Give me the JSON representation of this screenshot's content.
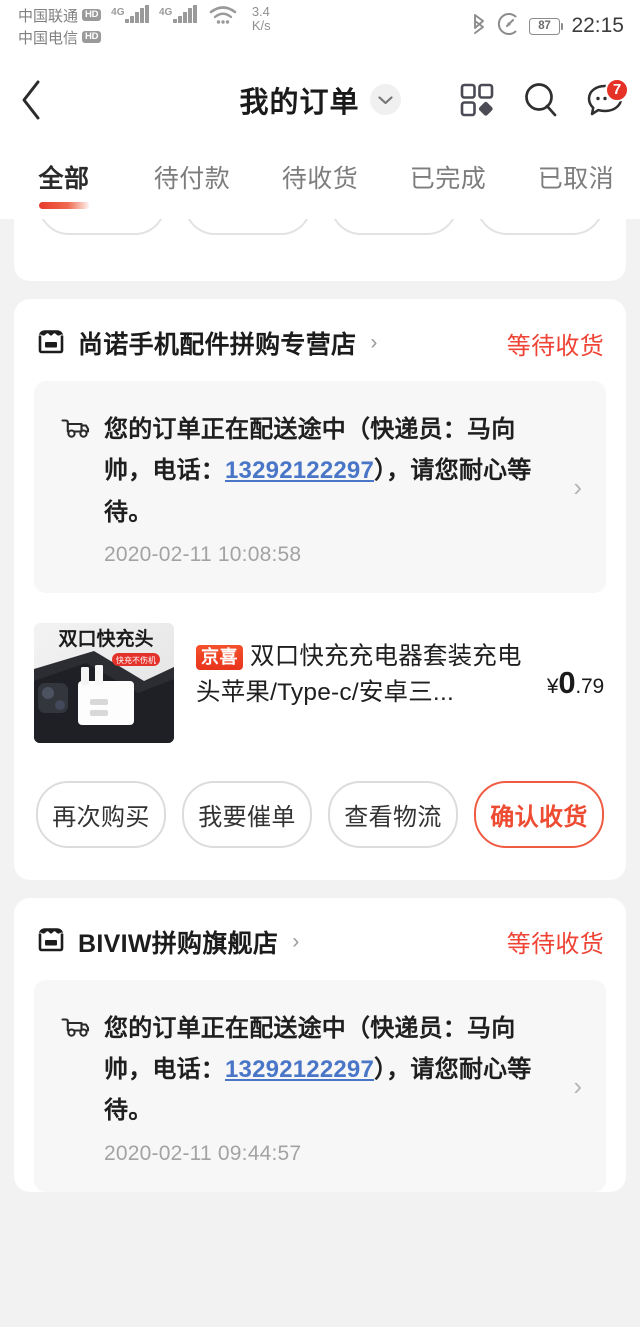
{
  "status_bar": {
    "carrier_1": "中国联通",
    "carrier_1_hd": "HD",
    "carrier_1_gen": "4G",
    "carrier_2": "中国电信",
    "carrier_2_hd": "HD",
    "carrier_2_gen": "4G",
    "net_speed_value": "3.4",
    "net_speed_unit": "K/s",
    "battery_percent": "87",
    "time": "22:15",
    "icons": [
      "bluetooth-icon",
      "data-saver-icon",
      "wifi-icon",
      "battery-icon"
    ]
  },
  "header": {
    "title": "我的订单",
    "back_icon": "chevron-left-icon",
    "dropdown_icon": "chevron-down-icon",
    "grid_icon": "grid-apps-icon",
    "search_icon": "search-icon",
    "chat_icon": "chat-bubble-icon",
    "chat_badge": "7"
  },
  "tabs": [
    {
      "label": "全部",
      "active": true
    },
    {
      "label": "待付款",
      "active": false
    },
    {
      "label": "待收货",
      "active": false
    },
    {
      "label": "已完成",
      "active": false
    },
    {
      "label": "已取消",
      "active": false
    }
  ],
  "colors": {
    "accent_red": "#ef4335",
    "badge_red": "#e63226",
    "link_blue": "#4a76c8",
    "page_bg": "#f2f2f2",
    "card_bg": "#ffffff",
    "notice_bg": "#f7f7f7"
  },
  "orders": [
    {
      "store_name": "尚诺手机配件拼购专营店",
      "store_icon": "storefront-icon",
      "store_arrow": "›",
      "status": "等待收货",
      "notice": {
        "icon": "delivery-truck-icon",
        "text_before": "您的订单正在配送途中（快递员：马向帅，电话：",
        "phone": "13292122297",
        "text_after": "），请您耐心等待。",
        "time": "2020-02-11 10:08:58",
        "chevron": "›"
      },
      "product": {
        "badge": "京喜",
        "title": "双口快充充电器套装充电头苹果/Type-c/安卓三...",
        "thumb_headline": "双口快充头",
        "thumb_tag": "快充不伤机",
        "currency": "¥",
        "price_int": "0",
        "price_dec": ".79"
      },
      "buttons": [
        {
          "label": "再次购买",
          "primary": false
        },
        {
          "label": "我要催单",
          "primary": false
        },
        {
          "label": "查看物流",
          "primary": false
        },
        {
          "label": "确认收货",
          "primary": true
        }
      ]
    },
    {
      "store_name": "BIVIW拼购旗舰店",
      "store_icon": "storefront-icon",
      "store_arrow": "›",
      "status": "等待收货",
      "notice": {
        "icon": "delivery-truck-icon",
        "text_before": "您的订单正在配送途中（快递员：马向帅，电话：",
        "phone": "13292122297",
        "text_after": "），请您耐心等待。",
        "time": "2020-02-11 09:44:57",
        "chevron": "›"
      }
    }
  ]
}
